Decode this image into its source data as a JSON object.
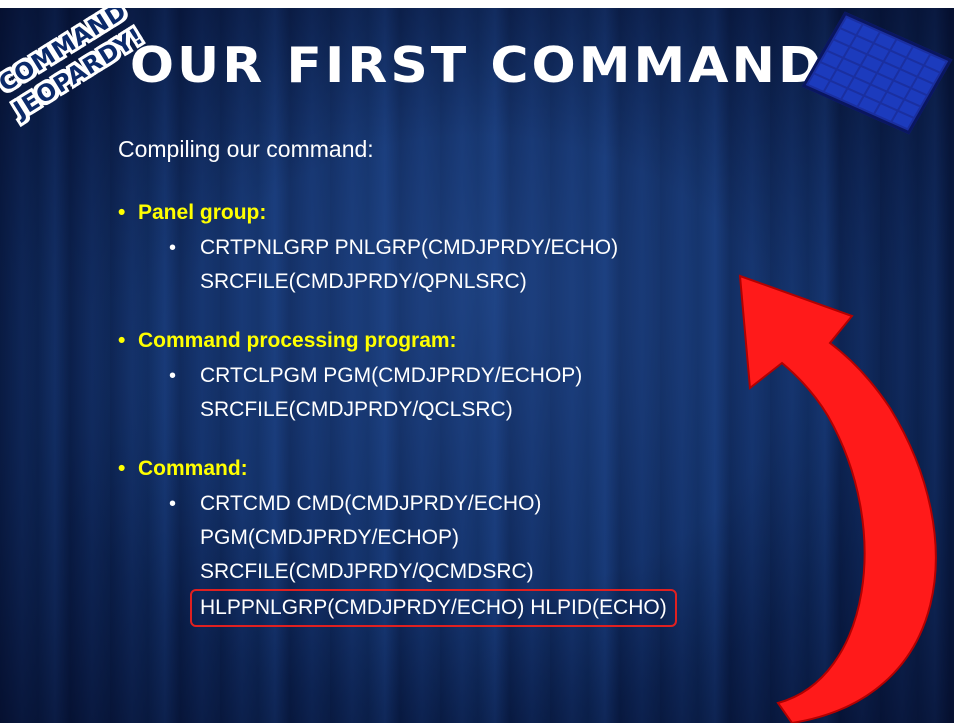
{
  "slide": {
    "title": "OUR FIRST COMMAND",
    "badge_line1": "COMMAND",
    "badge_line2": "JEOPARDY!",
    "intro": "Compiling our command:",
    "sections": [
      {
        "heading": "Panel group:",
        "lines": [
          "CRTPNLGRP PNLGRP(CMDJPRDY/ECHO)",
          "SRCFILE(CMDJPRDY/QPNLSRC)"
        ]
      },
      {
        "heading": "Command processing program:",
        "lines": [
          "CRTCLPGM PGM(CMDJPRDY/ECHOP)",
          "SRCFILE(CMDJPRDY/QCLSRC)"
        ]
      },
      {
        "heading": "Command:",
        "lines": [
          "CRTCMD CMD(CMDJPRDY/ECHO)",
          "PGM(CMDJPRDY/ECHOP)",
          "SRCFILE(CMDJPRDY/QCMDSRC)",
          "HLPPNLGRP(CMDJPRDY/ECHO) HLPID(ECHO)"
        ]
      }
    ],
    "bullet": "•",
    "colors": {
      "heading": "#ffff00",
      "text": "#ffffff",
      "arrow": "#ff1a1a",
      "highlight_border": "#e02020",
      "background": "#0e2a5d"
    }
  }
}
